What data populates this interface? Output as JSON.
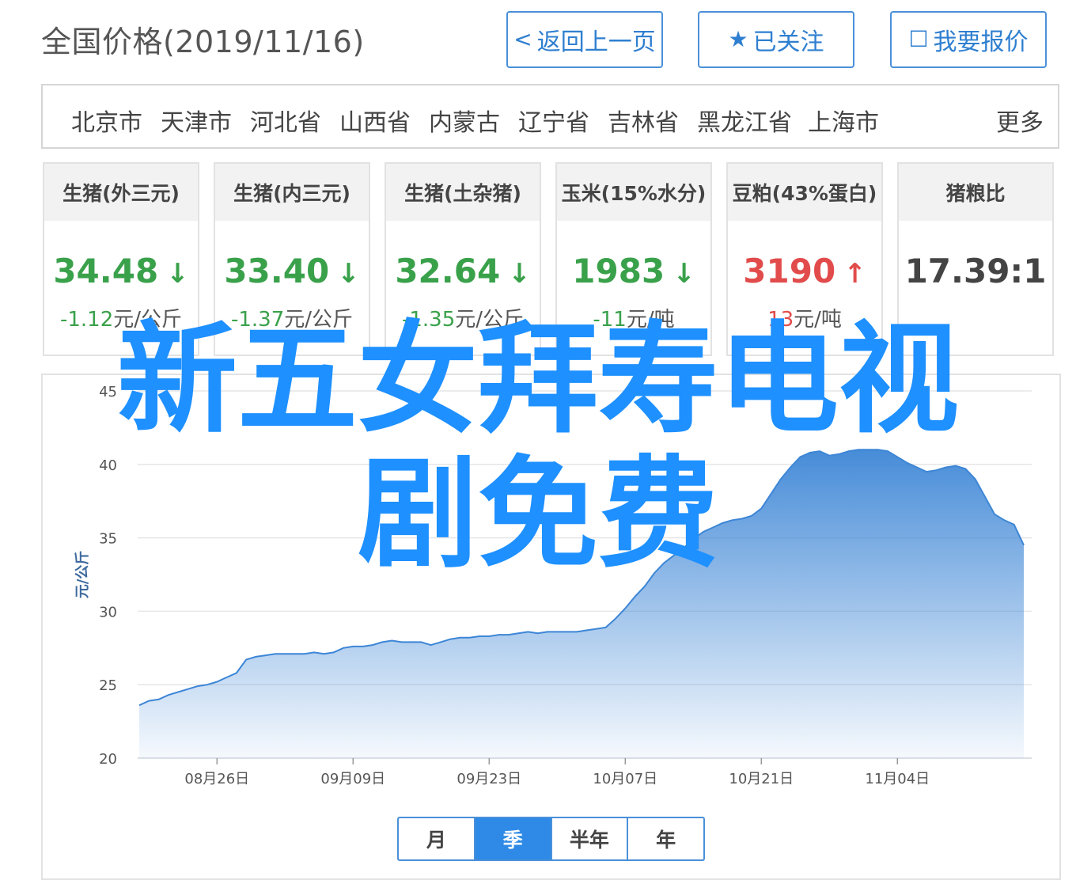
{
  "page_title": "全国价格(2019/11/16)",
  "buttons": {
    "back": {
      "icon": "chevron-left-icon",
      "glyph": "<",
      "label": "返回上一页"
    },
    "follow": {
      "icon": "star-icon",
      "glyph": "★",
      "label": "已关注"
    },
    "quote": {
      "icon": "edit-icon",
      "glyph": "☐",
      "label": "我要报价"
    }
  },
  "regions": [
    "北京市",
    "天津市",
    "河北省",
    "山西省",
    "内蒙古",
    "辽宁省",
    "吉林省",
    "黑龙江省",
    "上海市"
  ],
  "regions_more": "更多",
  "cards": [
    {
      "title": "生猪(外三元)",
      "value": "34.48",
      "arrow": "↓",
      "trend": "down",
      "change": "-1.12",
      "unit": "元/公斤"
    },
    {
      "title": "生猪(内三元)",
      "value": "33.40",
      "arrow": "↓",
      "trend": "down",
      "change": "-1.37",
      "unit": "元/公斤"
    },
    {
      "title": "生猪(土杂猪)",
      "value": "32.64",
      "arrow": "↓",
      "trend": "down",
      "change": "-1.35",
      "unit": "元/公斤"
    },
    {
      "title": "玉米(15%水分)",
      "value": "1983",
      "arrow": "↓",
      "trend": "down",
      "change": "-11",
      "unit": "元/吨"
    },
    {
      "title": "豆粕(43%蛋白)",
      "value": "3190",
      "arrow": "↑",
      "trend": "up",
      "change": "13",
      "unit": "元/吨"
    },
    {
      "title": "猪粮比",
      "value": "17.39:1",
      "arrow": "",
      "trend": "neutral",
      "change": "",
      "unit": ""
    }
  ],
  "watermark": {
    "line1": "新五女拜寿电视",
    "line2": "剧免费"
  },
  "colors": {
    "accent": "#2e8ae6",
    "down": "#3aa14b",
    "up": "#e24b4b",
    "series": "#3d86d6"
  },
  "range_tabs": [
    {
      "label": "月",
      "active": false
    },
    {
      "label": "季",
      "active": true
    },
    {
      "label": "半年",
      "active": false
    },
    {
      "label": "年",
      "active": false
    }
  ],
  "chart_data": {
    "type": "area",
    "title": "",
    "xlabel": "",
    "ylabel": "元/公斤",
    "ylim": [
      20,
      45
    ],
    "yticks": [
      20,
      25,
      30,
      35,
      40,
      45
    ],
    "xtick_labels": [
      "08月26日",
      "09月09日",
      "09月23日",
      "10月07日",
      "10月21日",
      "11月04日"
    ],
    "xtick_days": [
      8,
      22,
      36,
      50,
      64,
      78
    ],
    "xlim_days": [
      0,
      91
    ],
    "grid": true,
    "series": [
      {
        "name": "",
        "x_days": [
          0,
          1,
          2,
          3,
          4,
          5,
          6,
          7,
          8,
          9,
          10,
          11,
          12,
          13,
          14,
          15,
          16,
          17,
          18,
          19,
          20,
          21,
          22,
          23,
          24,
          25,
          26,
          27,
          28,
          29,
          30,
          31,
          32,
          33,
          34,
          35,
          36,
          37,
          38,
          39,
          40,
          41,
          42,
          43,
          44,
          45,
          46,
          47,
          48,
          49,
          50,
          51,
          52,
          53,
          54,
          55,
          56,
          57,
          58,
          59,
          60,
          61,
          62,
          63,
          64,
          65,
          66,
          67,
          68,
          69,
          70,
          71,
          72,
          73,
          74,
          75,
          76,
          77,
          78,
          79,
          80,
          81,
          82,
          83,
          84,
          85,
          86,
          87,
          88,
          89,
          90,
          91
        ],
        "values": [
          23.6,
          23.9,
          24.0,
          24.3,
          24.5,
          24.7,
          24.9,
          25.0,
          25.2,
          25.5,
          25.8,
          26.7,
          26.9,
          27.0,
          27.1,
          27.1,
          27.1,
          27.1,
          27.2,
          27.1,
          27.2,
          27.5,
          27.6,
          27.6,
          27.7,
          27.9,
          28.0,
          27.9,
          27.9,
          27.9,
          27.7,
          27.9,
          28.1,
          28.2,
          28.2,
          28.3,
          28.3,
          28.4,
          28.4,
          28.5,
          28.6,
          28.5,
          28.6,
          28.6,
          28.6,
          28.6,
          28.7,
          28.8,
          28.9,
          29.5,
          30.2,
          31.0,
          31.7,
          32.6,
          33.3,
          33.8,
          34.3,
          34.9,
          35.4,
          35.7,
          36.0,
          36.2,
          36.3,
          36.5,
          37.0,
          38.0,
          39.0,
          39.8,
          40.5,
          40.8,
          40.9,
          40.6,
          40.7,
          40.9,
          41.0,
          41.0,
          41.0,
          40.9,
          40.5,
          40.1,
          39.8,
          39.5,
          39.6,
          39.8,
          39.9,
          39.7,
          39.0,
          37.8,
          36.6,
          36.2,
          35.9,
          34.5
        ]
      }
    ]
  }
}
